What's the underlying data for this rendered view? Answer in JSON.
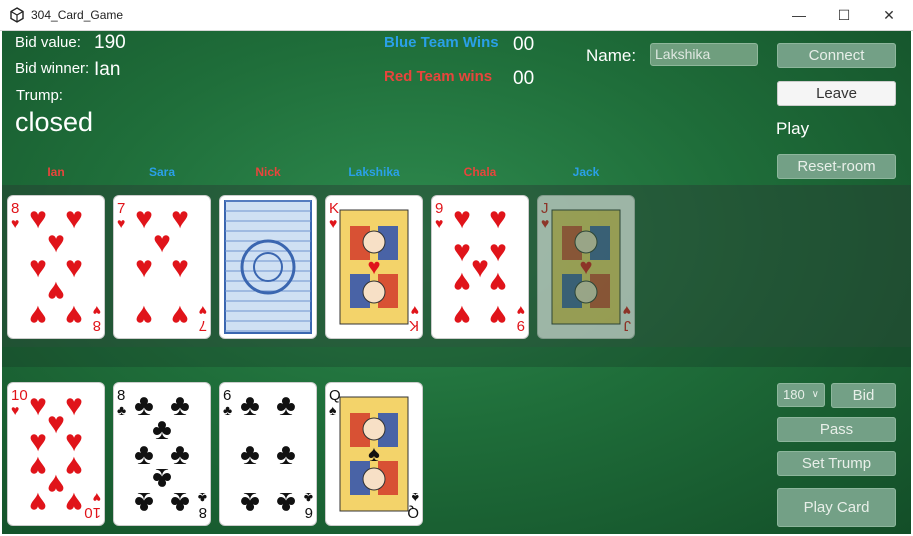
{
  "window": {
    "title": "304_Card_Game",
    "minimize": "—",
    "maximize": "☐",
    "close": "✕"
  },
  "bid": {
    "value_label": "Bid value:",
    "value": "190",
    "winner_label": "Bid winner:",
    "winner": "Ian",
    "trump_label": "Trump:",
    "trump": "closed"
  },
  "score": {
    "blue_label": "Blue Team Wins",
    "blue": "00",
    "red_label": "Red Team wins",
    "red": "00"
  },
  "name": {
    "label": "Name:",
    "value": "Lakshika"
  },
  "controls": {
    "connect": "Connect",
    "leave": "Leave",
    "status": "Play",
    "reset": "Reset-room"
  },
  "players": [
    {
      "name": "Ian",
      "team_color": "#e8453c"
    },
    {
      "name": "Sara",
      "team_color": "#2aa0e8"
    },
    {
      "name": "Nick",
      "team_color": "#e8453c"
    },
    {
      "name": "Lakshika",
      "team_color": "#2aa0e8"
    },
    {
      "name": "Chala",
      "team_color": "#e8453c"
    },
    {
      "name": "Jack",
      "team_color": "#2aa0e8"
    }
  ],
  "table_cards": [
    {
      "rank": "8",
      "suit": "hearts"
    },
    {
      "rank": "7",
      "suit": "hearts"
    },
    {
      "rank": "",
      "suit": "back"
    },
    {
      "rank": "K",
      "suit": "hearts"
    },
    {
      "rank": "9",
      "suit": "hearts"
    },
    {
      "rank": "J",
      "suit": "hearts"
    }
  ],
  "hand_cards": [
    {
      "rank": "10",
      "suit": "hearts"
    },
    {
      "rank": "8",
      "suit": "clubs"
    },
    {
      "rank": "6",
      "suit": "clubs"
    },
    {
      "rank": "Q",
      "suit": "spades"
    }
  ],
  "actions": {
    "bid_select": "180",
    "bid": "Bid",
    "pass": "Pass",
    "set_trump": "Set Trump",
    "play_card": "Play Card"
  }
}
